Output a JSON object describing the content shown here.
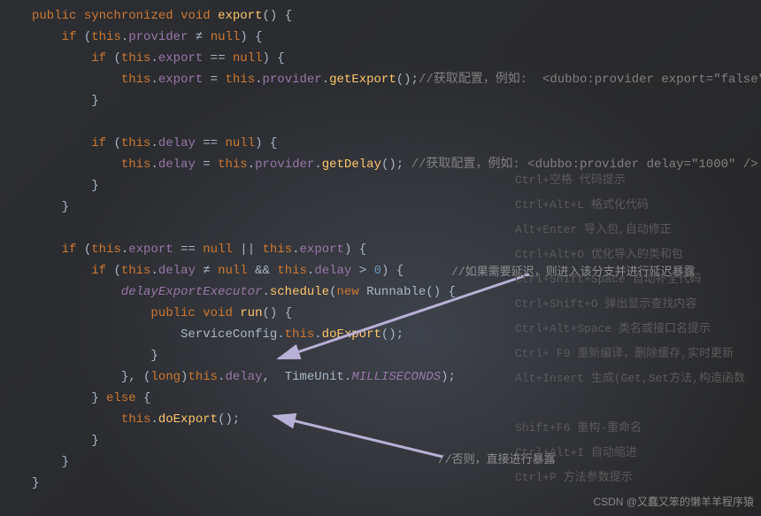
{
  "code": {
    "line1a": "public",
    "line1b": "synchronized",
    "line1c": "void",
    "line1d": "export",
    "line1e": "() {",
    "line2a": "if",
    "line2b": "(",
    "line2c": "this",
    "line2d": ".",
    "line2e": "provider",
    "line2f": " ≠ ",
    "line2g": "null",
    "line2h": ") {",
    "line3a": "if",
    "line3b": "(",
    "line3c": "this",
    "line3d": ".",
    "line3e": "export",
    "line3f": " == ",
    "line3g": "null",
    "line3h": ") {",
    "line4a": "this",
    "line4b": ".",
    "line4c": "export",
    "line4d": " = ",
    "line4e": "this",
    "line4f": ".",
    "line4g": "provider",
    "line4h": ".",
    "line4i": "getExport",
    "line4j": "();",
    "line4cm": "//获取配置，例如:  <dubbo:provider export=\"false\" />",
    "line5": "}",
    "line7a": "if",
    "line7b": "(",
    "line7c": "this",
    "line7d": ".",
    "line7e": "delay",
    "line7f": " == ",
    "line7g": "null",
    "line7h": ") {",
    "line8a": "this",
    "line8b": ".",
    "line8c": "delay",
    "line8d": " = ",
    "line8e": "this",
    "line8f": ".",
    "line8g": "provider",
    "line8h": ".",
    "line8i": "getDelay",
    "line8j": "();",
    "line8cm": "//获取配置，例如: <dubbo:provider delay=\"1000\" />",
    "line9": "}",
    "line10": "}",
    "line12a": "if",
    "line12b": "(",
    "line12c": "this",
    "line12d": ".",
    "line12e": "export",
    "line12f": " == ",
    "line12g": "null",
    "line12h": " || ",
    "line12i": "this",
    "line12j": ".",
    "line12k": "export",
    "line12l": ") {",
    "line13a": "if",
    "line13b": "(",
    "line13c": "this",
    "line13d": ".",
    "line13e": "delay",
    "line13f": " ≠ ",
    "line13g": "null",
    "line13h": " && ",
    "line13i": "this",
    "line13j": ".",
    "line13k": "delay",
    "line13l": " > ",
    "line13m": "0",
    "line13n": ") {",
    "line13ann": "//如果需要延迟，则进入该分支并进行延迟暴露",
    "line14a": "delayExportExecutor",
    "line14b": ".",
    "line14c": "schedule",
    "line14d": "(",
    "line14e": "new",
    "line14f": " Runnable() {",
    "line15a": "public",
    "line15b": "void",
    "line15c": "run",
    "line15d": "() {",
    "line16a": "ServiceConfig.",
    "line16b": "this",
    "line16c": ".",
    "line16d": "doExport",
    "line16e": "();",
    "line17": "}",
    "line18a": "}, (",
    "line18b": "long",
    "line18c": ")",
    "line18d": "this",
    "line18e": ".",
    "line18f": "delay",
    "line18g": ",  TimeUnit.",
    "line18h": "MILLISECONDS",
    "line18i": ");",
    "line19a": "} ",
    "line19b": "else",
    "line19c": " {",
    "line20a": "this",
    "line20b": ".",
    "line20c": "doExport",
    "line20d": "();",
    "line20ann": "//否则，直接进行暴露",
    "line21": "}",
    "line22": "}",
    "line23": "}"
  },
  "hints": {
    "h1": "Ctrl+空格  代码提示",
    "h2": "Ctrl+Alt+L  格式化代码",
    "h3": "Alt+Enter 导入包,自动修正",
    "h4": "Ctrl+Alt+O  优化导入的类和包",
    "h5": "Ctrl+Shift+Space 自动补全代码",
    "h6": "Ctrl+Shift+O  弹出显示查找内容",
    "h7": "Ctrl+Alt+Space  类名或接口名提示",
    "h8": "Ctrl+ F9 重新编译，删除缓存,实时更新",
    "h9": "Alt+Insert  生成(Get,Set方法,构造函数",
    "h10": "Shift+F6  重构-重命名",
    "h11": "Ctrl+Alt+I  自动缩进",
    "h12": "Ctrl+P  方法参数提示"
  },
  "watermark": "CSDN @又蠢又笨的懒羊羊程序猿"
}
